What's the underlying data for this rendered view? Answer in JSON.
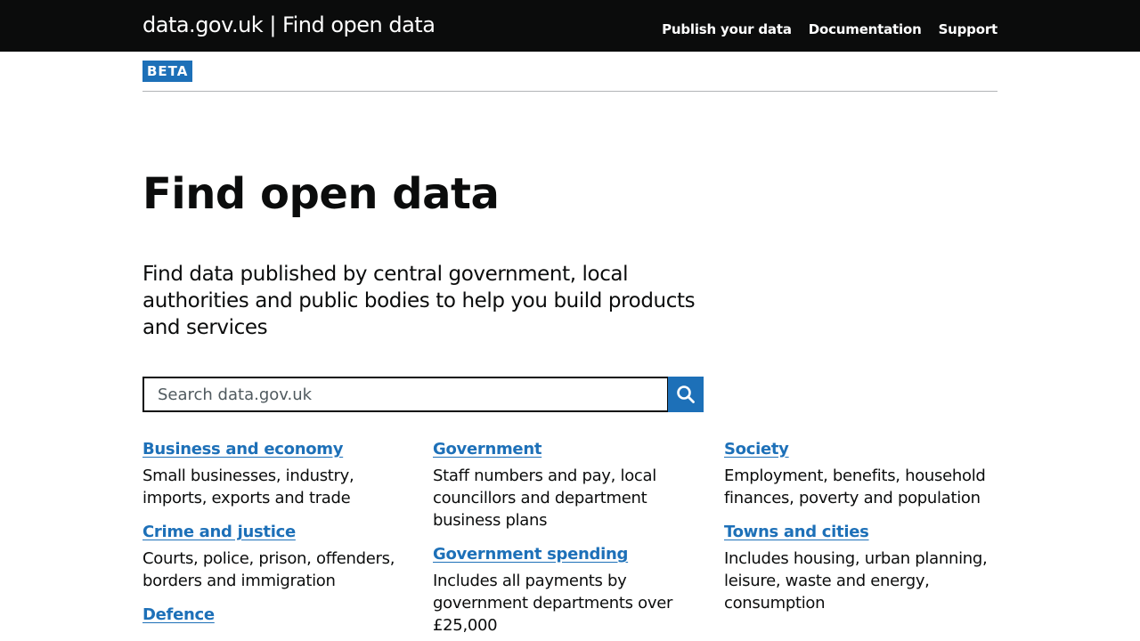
{
  "header": {
    "brand": "data.gov.uk | Find open data",
    "nav": [
      "Publish your data",
      "Documentation",
      "Support"
    ]
  },
  "phase_banner": {
    "tag": "BETA"
  },
  "main": {
    "title": "Find open data",
    "lead": "Find data published by central government, local authorities and public bodies to help you build products and services",
    "search": {
      "placeholder": "Search data.gov.uk",
      "value": "",
      "button_icon": "search-icon"
    }
  },
  "topics": {
    "col1": [
      {
        "title": "Business and economy",
        "description": "Small businesses, industry, imports, exports and trade"
      },
      {
        "title": "Crime and justice",
        "description": "Courts, police, prison, offenders, borders and immigration"
      },
      {
        "title": "Defence",
        "description": ""
      }
    ],
    "col2": [
      {
        "title": "Government",
        "description": "Staff numbers and pay, local councillors and department business plans"
      },
      {
        "title": "Government spending",
        "description": "Includes all payments by government departments over £25,000"
      }
    ],
    "col3": [
      {
        "title": "Society",
        "description": "Employment, benefits, household finances, poverty and population"
      },
      {
        "title": "Towns and cities",
        "description": "Includes housing, urban planning, leisure, waste and energy, consumption"
      }
    ]
  },
  "colors": {
    "header_bg": "#0b0c0c",
    "link": "#1d70b8",
    "text": "#0b0c0c"
  }
}
